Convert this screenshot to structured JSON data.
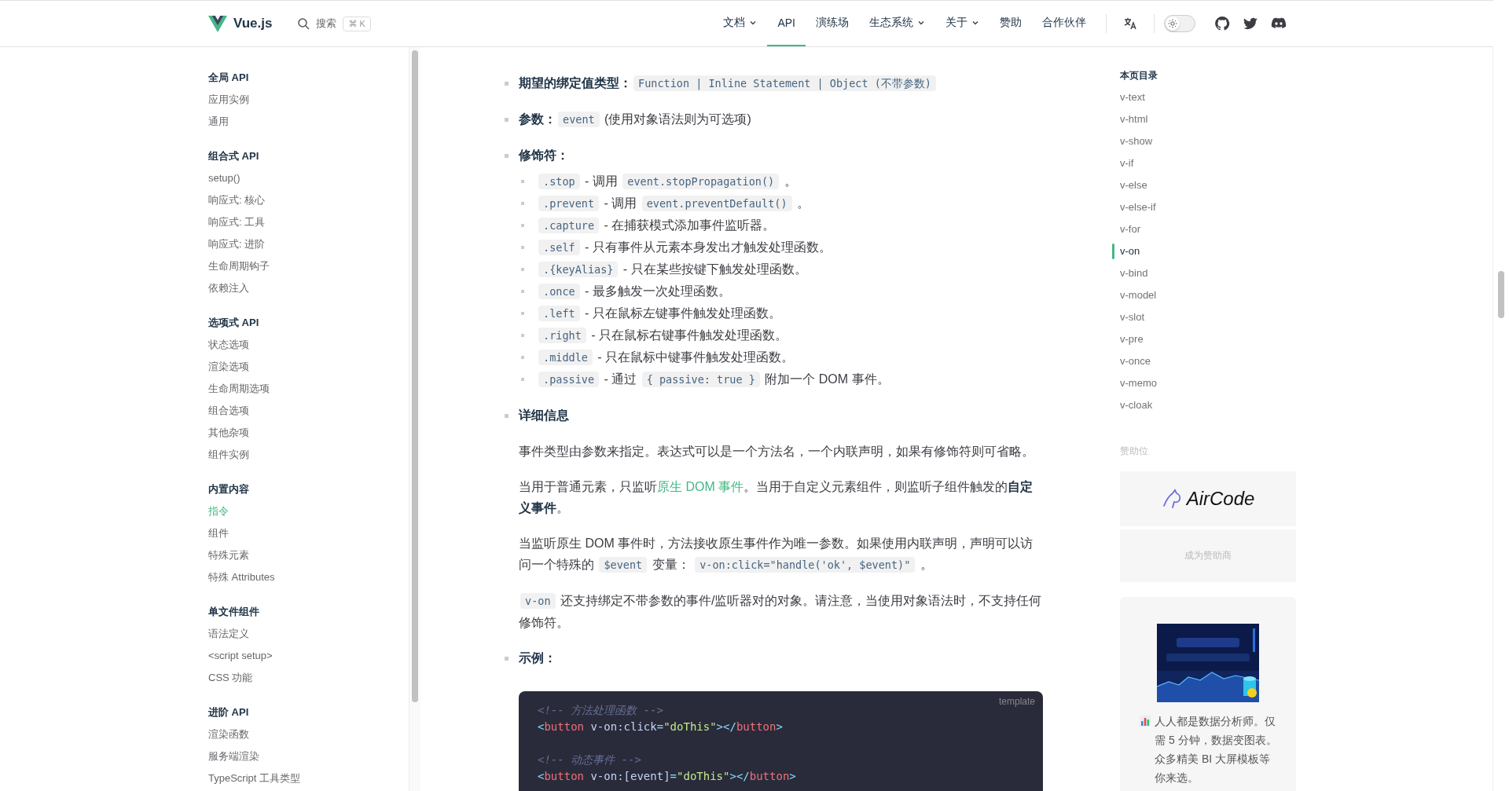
{
  "nav": {
    "logo": "Vue.js",
    "search": {
      "label": "搜索",
      "shortcut": "⌘ K"
    },
    "links": [
      {
        "label": "文档",
        "dropdown": true,
        "selected": false
      },
      {
        "label": "API",
        "dropdown": false,
        "selected": true
      },
      {
        "label": "演练场",
        "dropdown": false,
        "selected": false
      },
      {
        "label": "生态系统",
        "dropdown": true,
        "selected": false
      },
      {
        "label": "关于",
        "dropdown": true,
        "selected": false
      },
      {
        "label": "赞助",
        "dropdown": false,
        "selected": false
      },
      {
        "label": "合作伙伴",
        "dropdown": false,
        "selected": false
      }
    ],
    "dark_mode": false
  },
  "sidebar": {
    "groups": [
      {
        "title": "全局 API",
        "items": [
          {
            "label": "应用实例",
            "selected": false
          },
          {
            "label": "通用",
            "selected": false
          }
        ]
      },
      {
        "title": "组合式 API",
        "items": [
          {
            "label": "setup()",
            "selected": false
          },
          {
            "label": "响应式: 核心",
            "selected": false
          },
          {
            "label": "响应式: 工具",
            "selected": false
          },
          {
            "label": "响应式: 进阶",
            "selected": false
          },
          {
            "label": "生命周期钩子",
            "selected": false
          },
          {
            "label": "依赖注入",
            "selected": false
          }
        ]
      },
      {
        "title": "选项式 API",
        "items": [
          {
            "label": "状态选项",
            "selected": false
          },
          {
            "label": "渲染选项",
            "selected": false
          },
          {
            "label": "生命周期选项",
            "selected": false
          },
          {
            "label": "组合选项",
            "selected": false
          },
          {
            "label": "其他杂项",
            "selected": false
          },
          {
            "label": "组件实例",
            "selected": false
          }
        ]
      },
      {
        "title": "内置内容",
        "items": [
          {
            "label": "指令",
            "selected": true
          },
          {
            "label": "组件",
            "selected": false
          },
          {
            "label": "特殊元素",
            "selected": false
          },
          {
            "label": "特殊 Attributes",
            "selected": false
          }
        ]
      },
      {
        "title": "单文件组件",
        "items": [
          {
            "label": "语法定义",
            "selected": false
          },
          {
            "label": "<script setup>",
            "selected": false
          },
          {
            "label": "CSS 功能",
            "selected": false
          }
        ]
      },
      {
        "title": "进阶 API",
        "items": [
          {
            "label": "渲染函数",
            "selected": false
          },
          {
            "label": "服务端渲染",
            "selected": false
          },
          {
            "label": "TypeScript 工具类型",
            "selected": false
          }
        ]
      }
    ]
  },
  "content": {
    "blocks": [
      {
        "kind": "field",
        "label": "期望的绑定值类型：",
        "parts": [
          {
            "kind": "code",
            "s": "Function | Inline Statement | Object (不带参数)"
          }
        ]
      },
      {
        "kind": "field",
        "label": "参数：",
        "parts": [
          {
            "kind": "code",
            "s": "event"
          },
          {
            "kind": "text",
            "s": " (使用对象语法则为可选项)"
          }
        ]
      },
      {
        "kind": "list",
        "label": "修饰符：",
        "items": [
          [
            {
              "kind": "code",
              "s": ".stop"
            },
            {
              "kind": "text",
              "s": " - 调用 "
            },
            {
              "kind": "code",
              "s": "event.stopPropagation()"
            },
            {
              "kind": "text",
              "s": " 。"
            }
          ],
          [
            {
              "kind": "code",
              "s": ".prevent"
            },
            {
              "kind": "text",
              "s": " - 调用 "
            },
            {
              "kind": "code",
              "s": "event.preventDefault()"
            },
            {
              "kind": "text",
              "s": " 。"
            }
          ],
          [
            {
              "kind": "code",
              "s": ".capture"
            },
            {
              "kind": "text",
              "s": " - 在捕获模式添加事件监听器。"
            }
          ],
          [
            {
              "kind": "code",
              "s": ".self"
            },
            {
              "kind": "text",
              "s": " - 只有事件从元素本身发出才触发处理函数。"
            }
          ],
          [
            {
              "kind": "code",
              "s": ".{keyAlias}"
            },
            {
              "kind": "text",
              "s": " - 只在某些按键下触发处理函数。"
            }
          ],
          [
            {
              "kind": "code",
              "s": ".once"
            },
            {
              "kind": "text",
              "s": " - 最多触发一次处理函数。"
            }
          ],
          [
            {
              "kind": "code",
              "s": ".left"
            },
            {
              "kind": "text",
              "s": " - 只在鼠标左键事件触发处理函数。"
            }
          ],
          [
            {
              "kind": "code",
              "s": ".right"
            },
            {
              "kind": "text",
              "s": " - 只在鼠标右键事件触发处理函数。"
            }
          ],
          [
            {
              "kind": "code",
              "s": ".middle"
            },
            {
              "kind": "text",
              "s": " - 只在鼠标中键事件触发处理函数。"
            }
          ],
          [
            {
              "kind": "code",
              "s": ".passive"
            },
            {
              "kind": "text",
              "s": " - 通过 "
            },
            {
              "kind": "code",
              "s": "{ passive: true }"
            },
            {
              "kind": "text",
              "s": " 附加一个 DOM 事件。"
            }
          ]
        ]
      },
      {
        "kind": "details",
        "label": "详细信息",
        "paragraphs": [
          [
            {
              "kind": "text",
              "s": "事件类型由参数来指定。表达式可以是一个方法名，一个内联声明，如果有修饰符则可省略。"
            }
          ],
          [
            {
              "kind": "text",
              "s": "当用于普通元素，只监听"
            },
            {
              "kind": "link",
              "s": "原生 DOM 事件"
            },
            {
              "kind": "text",
              "s": "。当用于自定义元素组件，则监听子组件触发的"
            },
            {
              "kind": "bold",
              "s": "自定义事件"
            },
            {
              "kind": "text",
              "s": "。"
            }
          ],
          [
            {
              "kind": "text",
              "s": "当监听原生 DOM 事件时，方法接收原生事件作为唯一参数。如果使用内联声明，声明可以访问一个特殊的 "
            },
            {
              "kind": "code",
              "s": "$event"
            },
            {
              "kind": "text",
              "s": " 变量： "
            },
            {
              "kind": "code",
              "s": "v-on:click=\"handle('ok', $event)\""
            },
            {
              "kind": "text",
              "s": " 。"
            }
          ],
          [
            {
              "kind": "code",
              "s": "v-on"
            },
            {
              "kind": "text",
              "s": " 还支持绑定不带参数的事件/监听器对的对象。请注意，当使用对象语法时，不支持任何修饰符。"
            }
          ]
        ]
      },
      {
        "kind": "example",
        "label": "示例：",
        "code": {
          "lang": "template",
          "groups": [
            [
              [
                {
                  "kind": "comment",
                  "s": "<!-- 方法处理函数 -->"
                }
              ],
              [
                {
                  "kind": "punct",
                  "s": "<"
                },
                {
                  "kind": "tag",
                  "s": "button"
                },
                {
                  "kind": "attr",
                  "s": " v-on:click"
                },
                {
                  "kind": "punct",
                  "s": "="
                },
                {
                  "kind": "string",
                  "s": "\"doThis\""
                },
                {
                  "kind": "punct",
                  "s": "></"
                },
                {
                  "kind": "tag",
                  "s": "button"
                },
                {
                  "kind": "punct",
                  "s": ">"
                }
              ]
            ],
            [
              [
                {
                  "kind": "comment",
                  "s": "<!-- 动态事件 -->"
                }
              ],
              [
                {
                  "kind": "punct",
                  "s": "<"
                },
                {
                  "kind": "tag",
                  "s": "button"
                },
                {
                  "kind": "attr",
                  "s": " v-on:[event]"
                },
                {
                  "kind": "punct",
                  "s": "="
                },
                {
                  "kind": "string",
                  "s": "\"doThis\""
                },
                {
                  "kind": "punct",
                  "s": "></"
                },
                {
                  "kind": "tag",
                  "s": "button"
                },
                {
                  "kind": "punct",
                  "s": ">"
                }
              ]
            ]
          ]
        }
      }
    ]
  },
  "toc": {
    "title": "本页目录",
    "items": [
      {
        "label": "v-text",
        "selected": false
      },
      {
        "label": "v-html",
        "selected": false
      },
      {
        "label": "v-show",
        "selected": false
      },
      {
        "label": "v-if",
        "selected": false
      },
      {
        "label": "v-else",
        "selected": false
      },
      {
        "label": "v-else-if",
        "selected": false
      },
      {
        "label": "v-for",
        "selected": false
      },
      {
        "label": "v-on",
        "selected": true
      },
      {
        "label": "v-bind",
        "selected": false
      },
      {
        "label": "v-model",
        "selected": false
      },
      {
        "label": "v-slot",
        "selected": false
      },
      {
        "label": "v-pre",
        "selected": false
      },
      {
        "label": "v-once",
        "selected": false
      },
      {
        "label": "v-memo",
        "selected": false
      },
      {
        "label": "v-cloak",
        "selected": false
      }
    ]
  },
  "sponsors": {
    "title": "赞助位",
    "sponsor": "AirCode",
    "become": "成为赞助商"
  },
  "ad": {
    "text": "人人都是数据分析师。仅需 5 分钟，数据变图表。众多精美 BI 大屏模板等你来选。"
  }
}
